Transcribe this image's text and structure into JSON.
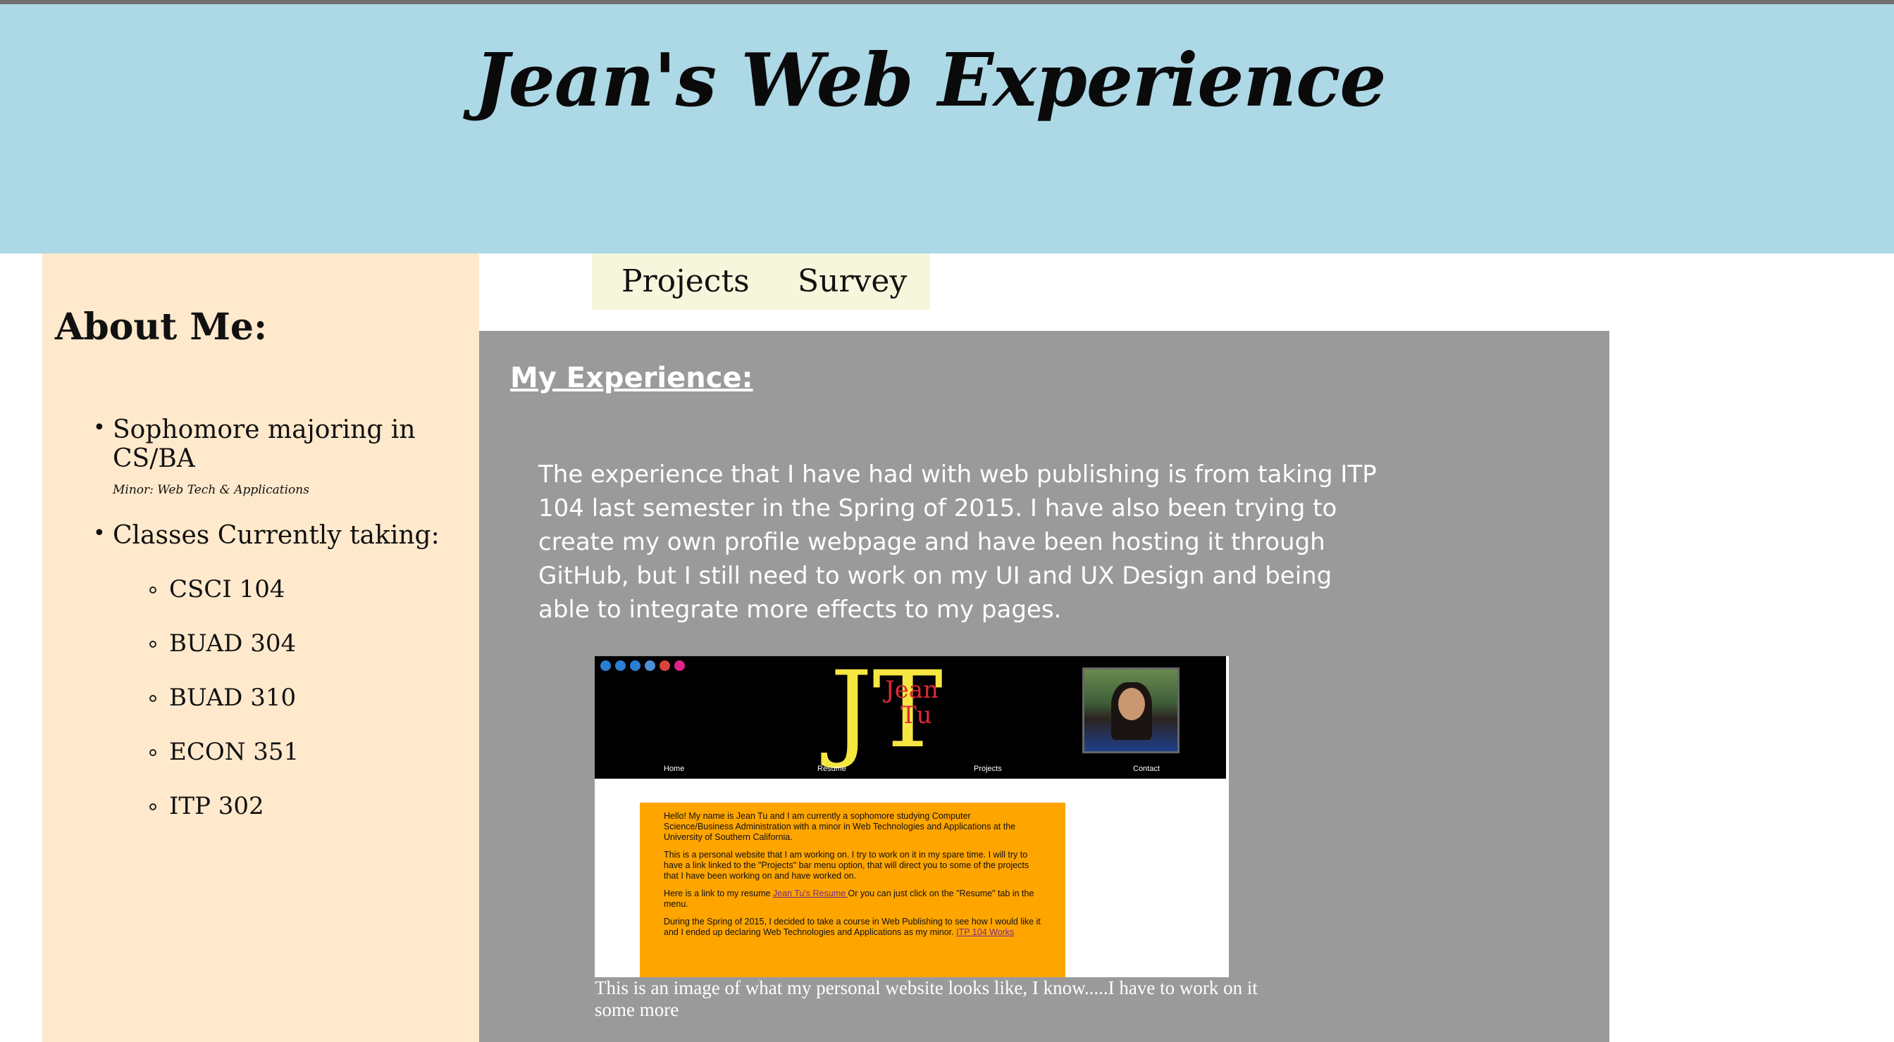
{
  "site": {
    "title": "Jean's Web Experience"
  },
  "sidebar": {
    "title": "About Me:",
    "items": [
      {
        "label": "Sophomore majoring in CS/BA",
        "note": "Minor: Web Tech & Applications"
      },
      {
        "label": "Classes Currently taking:"
      }
    ],
    "classes": [
      "CSCI 104",
      "BUAD 304",
      "BUAD 310",
      "ECON 351",
      "ITP 302"
    ]
  },
  "nav": {
    "items": [
      "Projects",
      "Survey"
    ]
  },
  "main": {
    "heading": "My Experience:",
    "paragraph": "The experience that I have had with web publishing is from taking ITP 104 last semester in the Spring of 2015. I have also been trying to create my own profile webpage and have been hosting it through GitHub, but I still need to work on my UI and UX Design and being able to integrate more effects to my pages.",
    "caption": "This is an image of what my personal website looks like, I know.....I have to work on it some more"
  },
  "screenshot": {
    "logo_initials": "JT",
    "logo_name_first": "Jean",
    "logo_name_last": "Tu",
    "nav": [
      "Home",
      "Resume",
      "Projects",
      "Contact"
    ],
    "para1": "Hello! My name is Jean Tu and I am currently a sophomore studying Computer Science/Business Administration with a minor in Web Technologies and Applications at the University of Southern California.",
    "para2": "This is a personal website that I am working on. I try to work on it in my spare time. I will try to have a link linked to the \"Projects\" bar menu option, that will direct you to some of the projects that I have been working on and have worked on.",
    "para3_before": "Here is a link to my resume ",
    "para3_link": "Jean Tu's Resume ",
    "para3_after": "Or you can just click on the \"Resume\" tab in the menu.",
    "para4_before": "During the Spring of 2015, I decided to take a course in Web Publishing to see how I would like it and I ended up declaring Web Technologies and Applications as my minor. ",
    "para4_link": "ITP 104 Works"
  },
  "colors": {
    "banner": "#add8e6",
    "sidebar": "#ffe9cc",
    "nav": "#f6f6dc",
    "content": "#9a9a9a",
    "screenshot_box": "#ffa500",
    "logo_yellow": "#f5e642",
    "logo_red": "#e0283a"
  }
}
